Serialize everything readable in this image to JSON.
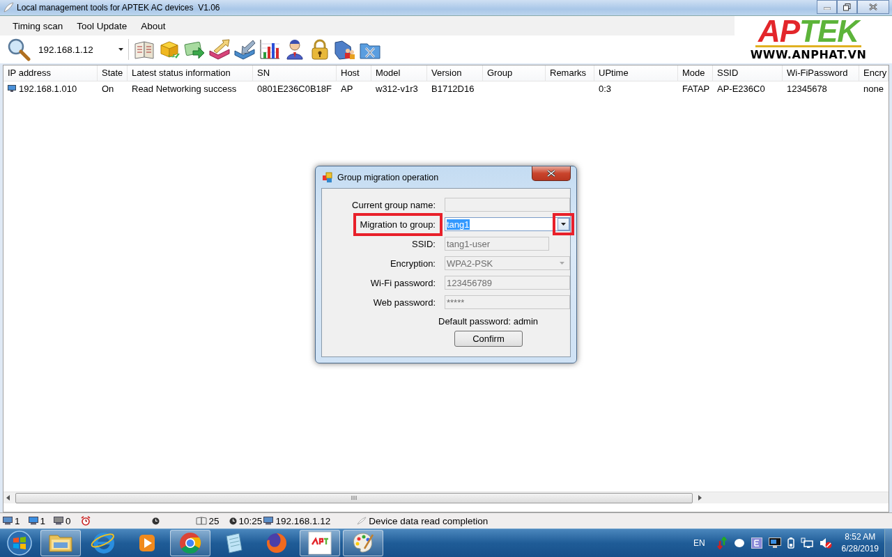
{
  "window": {
    "title": "Local management tools for APTEK AC devices  V1.06"
  },
  "menu": [
    "Timing scan",
    "Tool Update",
    "About"
  ],
  "toolbar": {
    "address": "192.168.1.12"
  },
  "logo": {
    "parts": [
      {
        "text": "AP",
        "color": "#e3262b"
      },
      {
        "text": "TEK",
        "color": "#5db43a"
      }
    ],
    "url": "WWW.ANPHAT.VN"
  },
  "table": {
    "columns": [
      "IP address",
      "State",
      "Latest status information",
      "SN",
      "Host",
      "Model",
      "Version",
      "Group",
      "Remarks",
      "UPtime",
      "Mode",
      "SSID",
      "Wi-FiPassword",
      "Encry"
    ],
    "rows": [
      {
        "ip": "192.168.1.010",
        "state": "On",
        "status": "Read Networking success",
        "sn": "0801E236C0B18F",
        "host": "AP",
        "model": "w312-v1r3",
        "version": "B1712D16",
        "uptime": "0:3",
        "mode": "FATAP",
        "ssid": "AP-E236C0",
        "wifi_password": "12345678",
        "encryption": "none"
      }
    ]
  },
  "dialog": {
    "title": "Group migration operation",
    "fields": [
      {
        "kind": "text",
        "label": "Current group name:",
        "disabled": true,
        "highlighted": false
      },
      {
        "kind": "combo",
        "label": "Migration to group:",
        "value": "tang1",
        "disabled": false,
        "text_selected": true,
        "highlighted": true
      },
      {
        "kind": "text",
        "label": "SSID:",
        "value": "tang1-user",
        "disabled": true,
        "highlighted": false
      },
      {
        "kind": "combo",
        "label": "Encryption:",
        "value": "WPA2-PSK",
        "disabled": true,
        "text_selected": false,
        "highlighted": false
      },
      {
        "kind": "text",
        "label": "Wi-Fi password:",
        "value": "123456789",
        "disabled": true,
        "highlighted": false
      },
      {
        "kind": "text",
        "label": "Web password:",
        "value": "*****",
        "disabled": true,
        "highlighted": false
      }
    ],
    "note": "Default password: admin",
    "button": "Confirm"
  },
  "status_bar": {
    "count_a": "1",
    "count_b": "1",
    "count_c": "0",
    "total": "25",
    "time": "10:25",
    "address": "192.168.1.12",
    "message": "Device data read completion"
  },
  "taskbar": {
    "apps": [
      {
        "running": true
      },
      {
        "running": false
      },
      {
        "running": false
      },
      {
        "running": true
      },
      {
        "running": false
      },
      {
        "running": false
      },
      {
        "running": true
      },
      {
        "running": true
      }
    ],
    "language": "EN",
    "time": "8:52 AM",
    "date": "6/28/2019"
  }
}
